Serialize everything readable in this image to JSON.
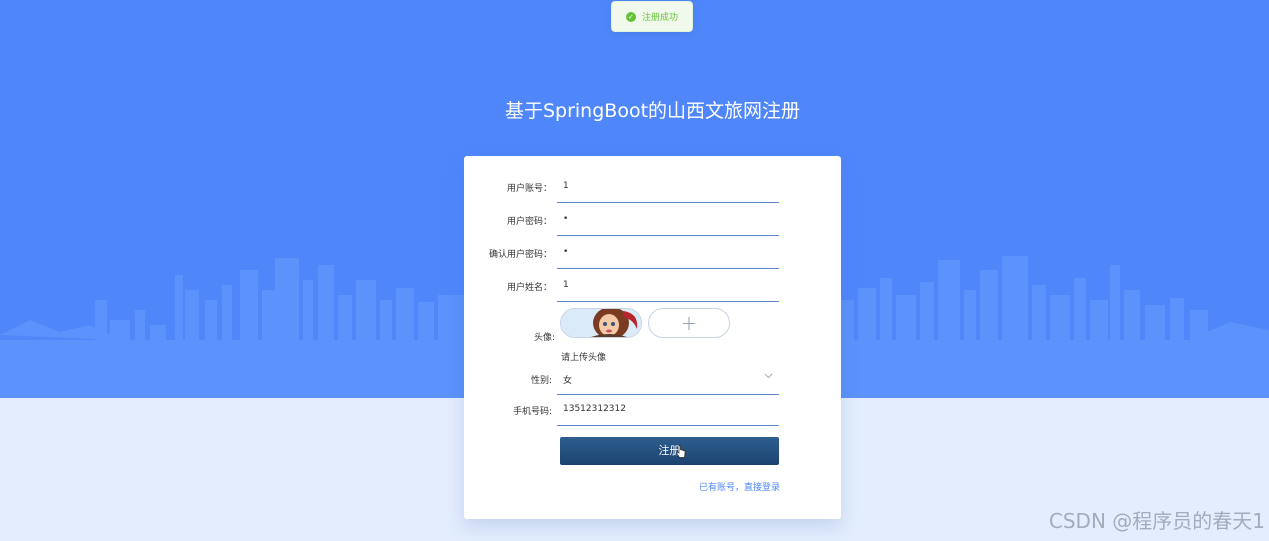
{
  "toast": {
    "message": "注册成功",
    "icon": "check-circle-icon",
    "color": "#67c23a"
  },
  "page": {
    "title": "基于SpringBoot的山西文旅网注册",
    "background": "#4f87fb"
  },
  "form": {
    "fields": [
      {
        "label": "用户账号：",
        "value": "1"
      },
      {
        "label": "用户密码：",
        "value": "•"
      },
      {
        "label": "确认用户密码：",
        "value": "•"
      },
      {
        "label": "用户姓名：",
        "value": "1"
      }
    ],
    "avatar": {
      "label": "头像:",
      "hint": "请上传头像",
      "upload_icon": "+"
    },
    "gender": {
      "label": "性别:",
      "value": "女"
    },
    "phone": {
      "label": "手机号码:",
      "value": "13512312312"
    },
    "submit_label": "注册",
    "login_link": "已有账号，直接登录"
  },
  "watermark": "CSDN @程序员的春天1"
}
